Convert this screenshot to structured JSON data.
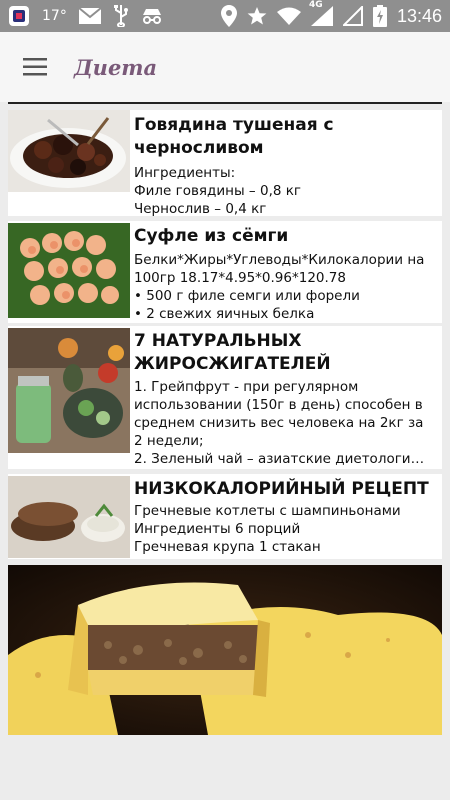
{
  "status_bar": {
    "temperature": "17°",
    "network": "4G",
    "time": "13:46"
  },
  "toolbar": {
    "title": "Диета"
  },
  "recipes": [
    {
      "title": "Говядина тушеная с черносливом",
      "lines": [
        "Ингредиенты:",
        "Филе говядины – 0,8 кг",
        "Чернослив – 0,4 кг"
      ],
      "image": "beef-prunes-photo"
    },
    {
      "title": "Суфле из сёмги",
      "lines": [
        "Белки*Жиры*Углеводы*Килокалории на 100гр 18.17*4.95*0.96*120.78",
        "• 500 г филе семги или форели",
        "• 2 свежих яичных белка"
      ],
      "image": "salmon-souffle-photo"
    },
    {
      "title": "7 НАТУРАЛЬНЫХ ЖИРОСЖИГАТЕЛЕЙ",
      "lines": [
        "1. Грейпфрут - при регулярном использовании (150г в день) способен в среднем снизить вес человека на 2кг за 2 недели;",
        "2. Зеленый чай – азиатские диетологи…"
      ],
      "image": "fat-burners-photo"
    },
    {
      "title": "НИЗКОКАЛОРИЙНЫЙ РЕЦЕПТ",
      "lines": [
        "Гречневые котлеты с шампиньонами",
        "Ингредиенты 6 порций",
        "Гречневая крупа 1 стакан"
      ],
      "image": "buckwheat-cutlets-photo"
    }
  ],
  "featured": {
    "image": "casserole-photo"
  }
}
